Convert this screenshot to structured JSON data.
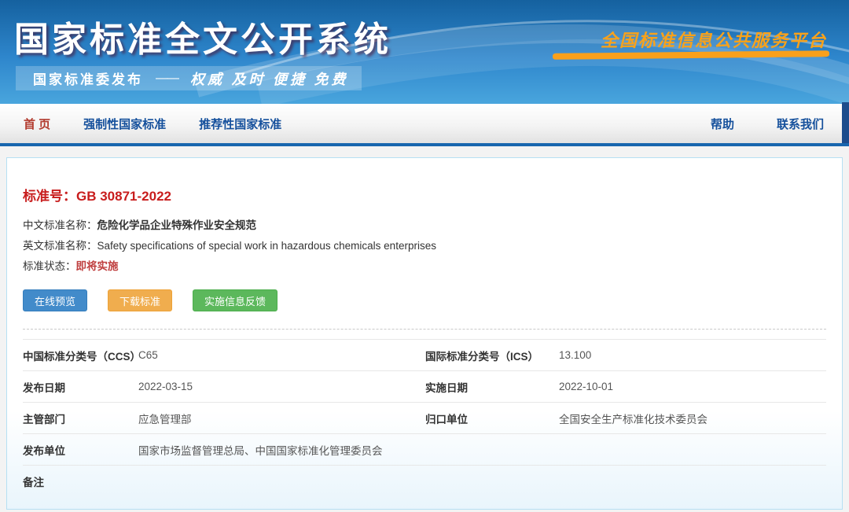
{
  "header": {
    "title": "国家标准全文公开系统",
    "publisher": "国家标准委发布",
    "dash": "——",
    "motto": "权威 及时 便捷 免费",
    "platform_name": "全国标准信息公共服务平台"
  },
  "nav": {
    "items": [
      {
        "label": "首 页"
      },
      {
        "label": "强制性国家标准"
      },
      {
        "label": "推荐性国家标准"
      }
    ],
    "right_items": [
      {
        "label": "帮助"
      },
      {
        "label": "联系我们"
      }
    ]
  },
  "detail": {
    "standard_no_label": "标准号：",
    "standard_no": "GB 30871-2022",
    "fields": [
      {
        "label": "中文标准名称：",
        "value": "危险化学品企业特殊作业安全规范"
      },
      {
        "label": "英文标准名称：",
        "value": "Safety specifications of special work in hazardous chemicals enterprises"
      },
      {
        "label": "标准状态：",
        "value": "即将实施"
      }
    ],
    "buttons": [
      {
        "label": "在线预览",
        "color": "#428bca"
      },
      {
        "label": "下载标准",
        "color": "#f0ad4e"
      },
      {
        "label": "实施信息反馈",
        "color": "#5cb85c"
      }
    ],
    "info_table": {
      "rows": [
        {
          "cells": [
            {
              "label": "中国标准分类号（CCS）",
              "value": "C65"
            },
            {
              "label": "国际标准分类号（ICS）",
              "value": "13.100"
            }
          ]
        },
        {
          "cells": [
            {
              "label": "发布日期",
              "value": "2022-03-15"
            },
            {
              "label": "实施日期",
              "value": "2022-10-01"
            }
          ]
        },
        {
          "cells": [
            {
              "label": "主管部门",
              "value": "应急管理部"
            },
            {
              "label": "归口单位",
              "value": "全国安全生产标准化技术委员会"
            }
          ]
        },
        {
          "cells": [
            {
              "label": "发布单位",
              "value": "国家市场监督管理总局、中国国家标准化管理委员会"
            }
          ]
        },
        {
          "cells": [
            {
              "label": "备注",
              "value": ""
            }
          ]
        }
      ]
    }
  },
  "colors": {
    "header_blue_top": "#15619f",
    "header_blue_bottom": "#49a5dd",
    "accent_orange": "#f9a21a",
    "nav_link_blue": "#15509c",
    "nav_active_red": "#b23b2e",
    "nav_border_blue": "#1866ae",
    "standard_no_red": "#c81d1d",
    "status_red": "#c04040",
    "button_blue": "#428bca",
    "button_orange": "#f0ad4e",
    "button_green": "#5cb85c",
    "panel_border_blue": "#b6e0f3"
  }
}
